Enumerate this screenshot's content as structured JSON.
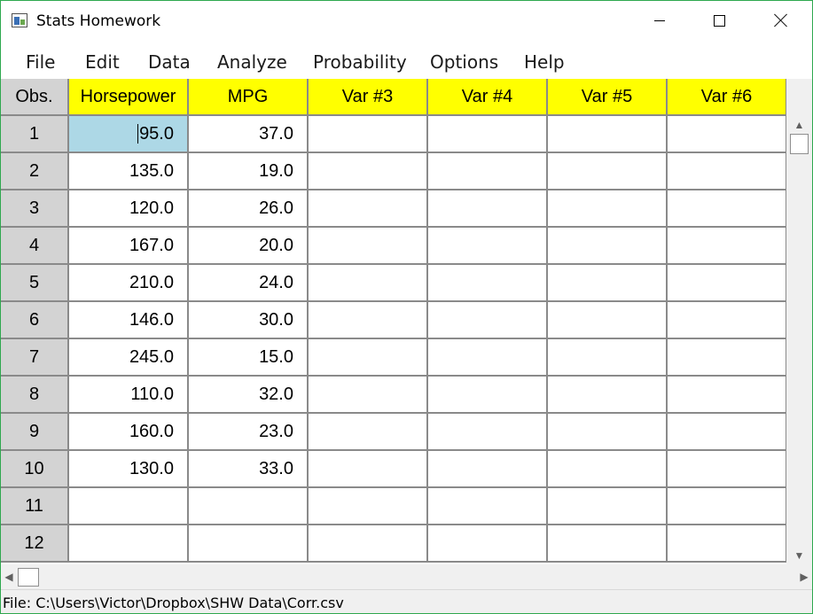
{
  "window": {
    "title": "Stats Homework",
    "minimize_glyph": "—",
    "maximize_glyph": "☐",
    "close_glyph": "✕"
  },
  "menu": [
    {
      "label": "File"
    },
    {
      "label": "Edit"
    },
    {
      "label": "Data"
    },
    {
      "label": "Analyze"
    },
    {
      "label": "Probability"
    },
    {
      "label": "Options"
    },
    {
      "label": "Help"
    }
  ],
  "grid": {
    "corner_label": "Obs.",
    "columns": [
      "Horsepower",
      "MPG",
      "Var #3",
      "Var #4",
      "Var #5",
      "Var #6"
    ],
    "row_labels": [
      "1",
      "2",
      "3",
      "4",
      "5",
      "6",
      "7",
      "8",
      "9",
      "10",
      "11",
      "12"
    ],
    "cells": [
      [
        "95.0",
        "37.0",
        "",
        "",
        "",
        ""
      ],
      [
        "135.0",
        "19.0",
        "",
        "",
        "",
        ""
      ],
      [
        "120.0",
        "26.0",
        "",
        "",
        "",
        ""
      ],
      [
        "167.0",
        "20.0",
        "",
        "",
        "",
        ""
      ],
      [
        "210.0",
        "24.0",
        "",
        "",
        "",
        ""
      ],
      [
        "146.0",
        "30.0",
        "",
        "",
        "",
        ""
      ],
      [
        "245.0",
        "15.0",
        "",
        "",
        "",
        ""
      ],
      [
        "110.0",
        "32.0",
        "",
        "",
        "",
        ""
      ],
      [
        "160.0",
        "23.0",
        "",
        "",
        "",
        ""
      ],
      [
        "130.0",
        "33.0",
        "",
        "",
        "",
        ""
      ],
      [
        "",
        "",
        "",
        "",
        "",
        ""
      ],
      [
        "",
        "",
        "",
        "",
        "",
        ""
      ]
    ],
    "selected_row": 0,
    "selected_col": 0
  },
  "status": {
    "text": "File: C:\\Users\\Victor\\Dropbox\\SHW Data\\Corr.csv"
  },
  "colors": {
    "header_yellow": "#ffff00",
    "rowhead_gray": "#d3d3d3",
    "selected_blue": "#add8e6",
    "window_border": "#2ea84e"
  },
  "icons": {
    "app": "app-icon",
    "scroll_up": "▲",
    "scroll_down": "▼",
    "scroll_left": "◀",
    "scroll_right": "▶"
  }
}
